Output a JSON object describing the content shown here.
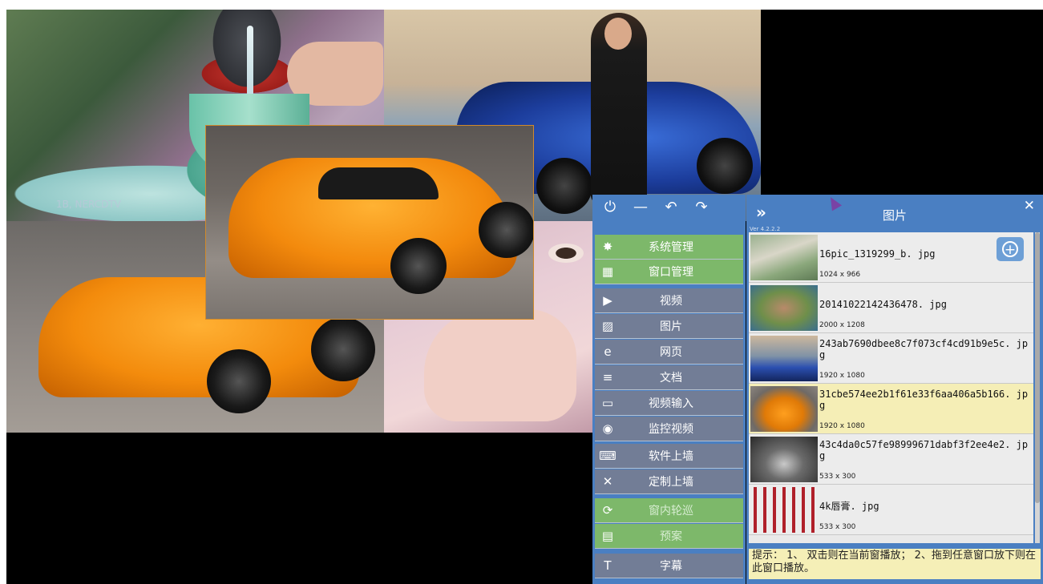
{
  "wall": {
    "watermark": "1B, NERCDTV"
  },
  "left_menu": {
    "toolbar": [
      {
        "name": "power-icon",
        "glyph": "⏻"
      },
      {
        "name": "minimize-icon",
        "glyph": "—"
      },
      {
        "name": "undo-icon",
        "glyph": "↶"
      },
      {
        "name": "redo-icon",
        "glyph": "↷"
      }
    ],
    "items": [
      {
        "label": "系统管理",
        "icon": "gear-icon",
        "glyph": "✸",
        "style": "green"
      },
      {
        "label": "窗口管理",
        "icon": "grid-icon",
        "glyph": "▦",
        "style": "green"
      },
      {
        "label": "视频",
        "icon": "video-icon",
        "glyph": "▶",
        "style": "grey"
      },
      {
        "label": "图片",
        "icon": "picture-icon",
        "glyph": "▨",
        "style": "grey"
      },
      {
        "label": "网页",
        "icon": "browser-icon",
        "glyph": "e",
        "style": "grey"
      },
      {
        "label": "文档",
        "icon": "document-icon",
        "glyph": "≡",
        "style": "grey"
      },
      {
        "label": "视频输入",
        "icon": "video-input-icon",
        "glyph": "▭",
        "style": "grey"
      },
      {
        "label": "监控视频",
        "icon": "camera-icon",
        "glyph": "◉",
        "style": "grey"
      },
      {
        "label": "软件上墙",
        "icon": "software-icon",
        "glyph": "⌨",
        "style": "grey"
      },
      {
        "label": "定制上墙",
        "icon": "tools-icon",
        "glyph": "✕",
        "style": "grey"
      },
      {
        "label": "窗内轮巡",
        "icon": "cycle-icon",
        "glyph": "⟳",
        "style": "green"
      },
      {
        "label": "预案",
        "icon": "plan-icon",
        "glyph": "▤",
        "style": "green"
      },
      {
        "label": "字幕",
        "icon": "subtitle-icon",
        "glyph": "T",
        "style": "grey"
      }
    ]
  },
  "right_panel": {
    "title": "图片",
    "version": "Ver 4.2.2.2",
    "expand_glyph": "»",
    "close_glyph": "✕",
    "add_glyph": "+",
    "files": [
      {
        "name": "16pic_1319299_b. jpg",
        "size": "1024 x 966",
        "selected": false
      },
      {
        "name": "20141022142436478. jpg",
        "size": "2000 x 1208",
        "selected": false
      },
      {
        "name": "243ab7690dbee8c7f073cf4cd91b9e5c. jpg",
        "size": "1920 x 1080",
        "selected": false
      },
      {
        "name": "31cbe574ee2b1f61e33f6aa406a5b166. jpg",
        "size": "1920 x 1080",
        "selected": true
      },
      {
        "name": "43c4da0c57fe98999671dabf3f2ee4e2. jpg",
        "size": "533 x 300",
        "selected": false
      },
      {
        "name": "4k唇膏. jpg",
        "size": "533 x 300",
        "selected": false
      }
    ],
    "hint": "提示： 1、 双击则在当前窗播放； 2、拖到任意窗口放下则在此窗口播放。"
  }
}
